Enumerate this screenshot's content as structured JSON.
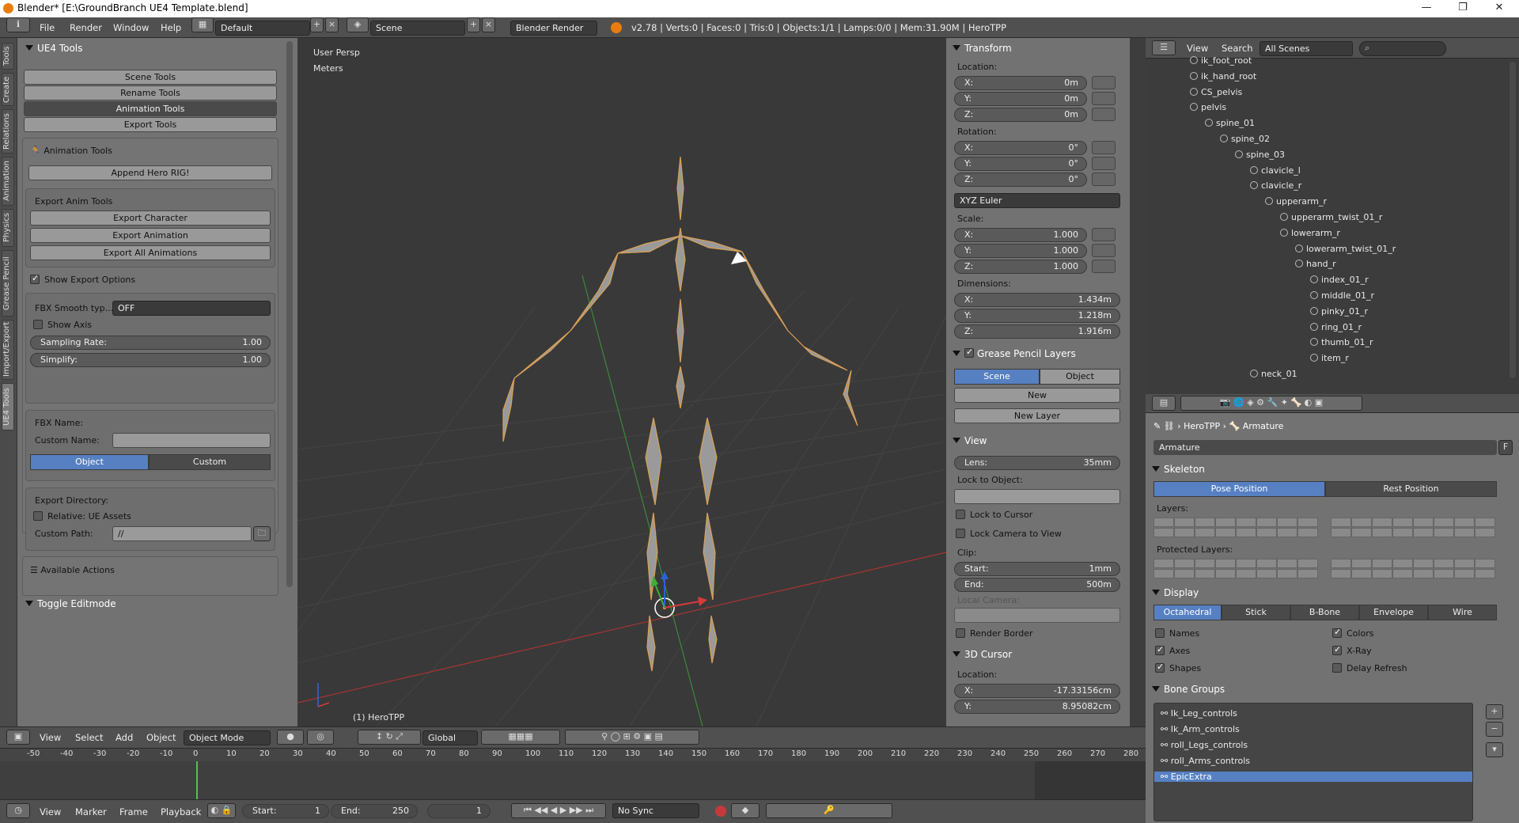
{
  "window": {
    "title": "Blender* [E:\\GroundBranch UE4 Template.blend]",
    "minimize": "—",
    "maximize": "❐",
    "close": "✕"
  },
  "menu": {
    "items": [
      "File",
      "Render",
      "Window",
      "Help"
    ],
    "layout": "Default",
    "scene": "Scene",
    "engine": "Blender Render",
    "stats": "v2.78 | Verts:0 | Faces:0 | Tris:0 | Objects:1/1 | Lamps:0/0 | Mem:31.90M | HeroTPP"
  },
  "vtabs": [
    "Tools",
    "Create",
    "Relations",
    "Animation",
    "Physics",
    "Grease Pencil",
    "Import/Export",
    "UE4 Tools"
  ],
  "left": {
    "header": "UE4 Tools",
    "tools": [
      "Scene Tools",
      "Rename Tools",
      "Animation Tools",
      "Export Tools"
    ],
    "anim_header": "Animation Tools",
    "append": "Append Hero RIG!",
    "export_header": "Export Anim Tools",
    "export_buttons": [
      "Export  Character",
      "Export Animation",
      "Export All Animations"
    ],
    "show_export": "Show Export Options",
    "fbx_smooth_label": "FBX Smooth typ...",
    "fbx_smooth_value": "OFF",
    "show_axis": "Show Axis",
    "sampling_label": "Sampling Rate:",
    "sampling_value": "1.00",
    "simplify_label": "Simplify:",
    "simplify_value": "1.00",
    "fbx_name": "FBX Name:",
    "custom_name": "Custom Name:",
    "obj_tab": "Object",
    "custom_tab": "Custom",
    "export_dir": "Export Directory:",
    "relative": "Relative: UE Assets",
    "custom_path_label": "Custom Path:",
    "custom_path": "//",
    "available": "Available Actions",
    "toggle": "Toggle Editmode"
  },
  "viewport": {
    "persp": "User Persp",
    "units": "Meters",
    "object": "(1) HeroTPP"
  },
  "right": {
    "transform": "Transform",
    "location": "Location:",
    "loc": [
      {
        "a": "X:",
        "v": "0m"
      },
      {
        "a": "Y:",
        "v": "0m"
      },
      {
        "a": "Z:",
        "v": "0m"
      }
    ],
    "rotation": "Rotation:",
    "rot": [
      {
        "a": "X:",
        "v": "0°"
      },
      {
        "a": "Y:",
        "v": "0°"
      },
      {
        "a": "Z:",
        "v": "0°"
      }
    ],
    "rot_mode": "XYZ Euler",
    "scale": "Scale:",
    "scl": [
      {
        "a": "X:",
        "v": "1.000"
      },
      {
        "a": "Y:",
        "v": "1.000"
      },
      {
        "a": "Z:",
        "v": "1.000"
      }
    ],
    "dimensions": "Dimensions:",
    "dim": [
      {
        "a": "X:",
        "v": "1.434m"
      },
      {
        "a": "Y:",
        "v": "1.218m"
      },
      {
        "a": "Z:",
        "v": "1.916m"
      }
    ],
    "gp": "Grease Pencil Layers",
    "gp_scene": "Scene",
    "gp_object": "Object",
    "gp_new": "New",
    "gp_new_layer": "New Layer",
    "view": "View",
    "lens_label": "Lens:",
    "lens": "35mm",
    "lock_obj": "Lock to Object:",
    "lock_cursor": "Lock to Cursor",
    "lock_cam": "Lock Camera to View",
    "clip": "Clip:",
    "clip_start_label": "Start:",
    "clip_start": "1mm",
    "clip_end_label": "End:",
    "clip_end": "500m",
    "local_cam": "Local Camera:",
    "render_border": "Render Border",
    "cursor": "3D Cursor",
    "cursor_loc": "Location:",
    "cx_label": "X:",
    "cx": "-17.33156cm",
    "cy_label": "Y:",
    "cy": "8.95082cm"
  },
  "outliner": {
    "view": "View",
    "search": "Search",
    "scenes": "All Scenes",
    "items": [
      {
        "name": "ik_foot_root",
        "d": 4
      },
      {
        "name": "ik_hand_root",
        "d": 4
      },
      {
        "name": "CS_pelvis",
        "d": 4
      },
      {
        "name": "pelvis",
        "d": 4
      },
      {
        "name": "spine_01",
        "d": 5
      },
      {
        "name": "spine_02",
        "d": 6
      },
      {
        "name": "spine_03",
        "d": 7
      },
      {
        "name": "clavicle_l",
        "d": 8
      },
      {
        "name": "clavicle_r",
        "d": 8
      },
      {
        "name": "upperarm_r",
        "d": 9
      },
      {
        "name": "upperarm_twist_01_r",
        "d": 10
      },
      {
        "name": "lowerarm_r",
        "d": 10
      },
      {
        "name": "lowerarm_twist_01_r",
        "d": 11
      },
      {
        "name": "hand_r",
        "d": 11
      },
      {
        "name": "index_01_r",
        "d": 12
      },
      {
        "name": "middle_01_r",
        "d": 12
      },
      {
        "name": "pinky_01_r",
        "d": 12
      },
      {
        "name": "ring_01_r",
        "d": 12
      },
      {
        "name": "thumb_01_r",
        "d": 12
      },
      {
        "name": "item_r",
        "d": 12
      },
      {
        "name": "neck_01",
        "d": 8
      }
    ]
  },
  "props": {
    "bc_obj": "HeroTPP",
    "bc_data": "Armature",
    "name": "Armature",
    "f": "F",
    "skeleton": "Skeleton",
    "pose": "Pose Position",
    "rest": "Rest Position",
    "layers": "Layers:",
    "protected": "Protected Layers:",
    "display": "Display",
    "disp_tabs": [
      "Octahedral",
      "Stick",
      "B-Bone",
      "Envelope",
      "Wire"
    ],
    "names": "Names",
    "axes": "Axes",
    "shapes": "Shapes",
    "colors": "Colors",
    "xray": "X-Ray",
    "delay": "Delay Refresh",
    "bone_groups": "Bone Groups",
    "groups": [
      "Ik_Leg_controls",
      "Ik_Arm_controls",
      "roll_Legs_controls",
      "roll_Arms_controls",
      "EpicExtra"
    ]
  },
  "vp_header": {
    "menus": [
      "View",
      "Select",
      "Add",
      "Object"
    ],
    "mode": "Object Mode",
    "orient": "Global"
  },
  "timeline": {
    "ticks": [
      "-50",
      "-40",
      "-30",
      "-20",
      "-10",
      "0",
      "10",
      "20",
      "30",
      "40",
      "50",
      "60",
      "70",
      "80",
      "90",
      "100",
      "110",
      "120",
      "130",
      "140",
      "150",
      "160",
      "170",
      "180",
      "190",
      "200",
      "210",
      "220",
      "230",
      "240",
      "250",
      "260",
      "270",
      "280"
    ],
    "menus": [
      "View",
      "Marker",
      "Frame",
      "Playback"
    ],
    "start_label": "Start:",
    "start": "1",
    "end_label": "End:",
    "end": "250",
    "current": "1",
    "sync": "No Sync"
  }
}
